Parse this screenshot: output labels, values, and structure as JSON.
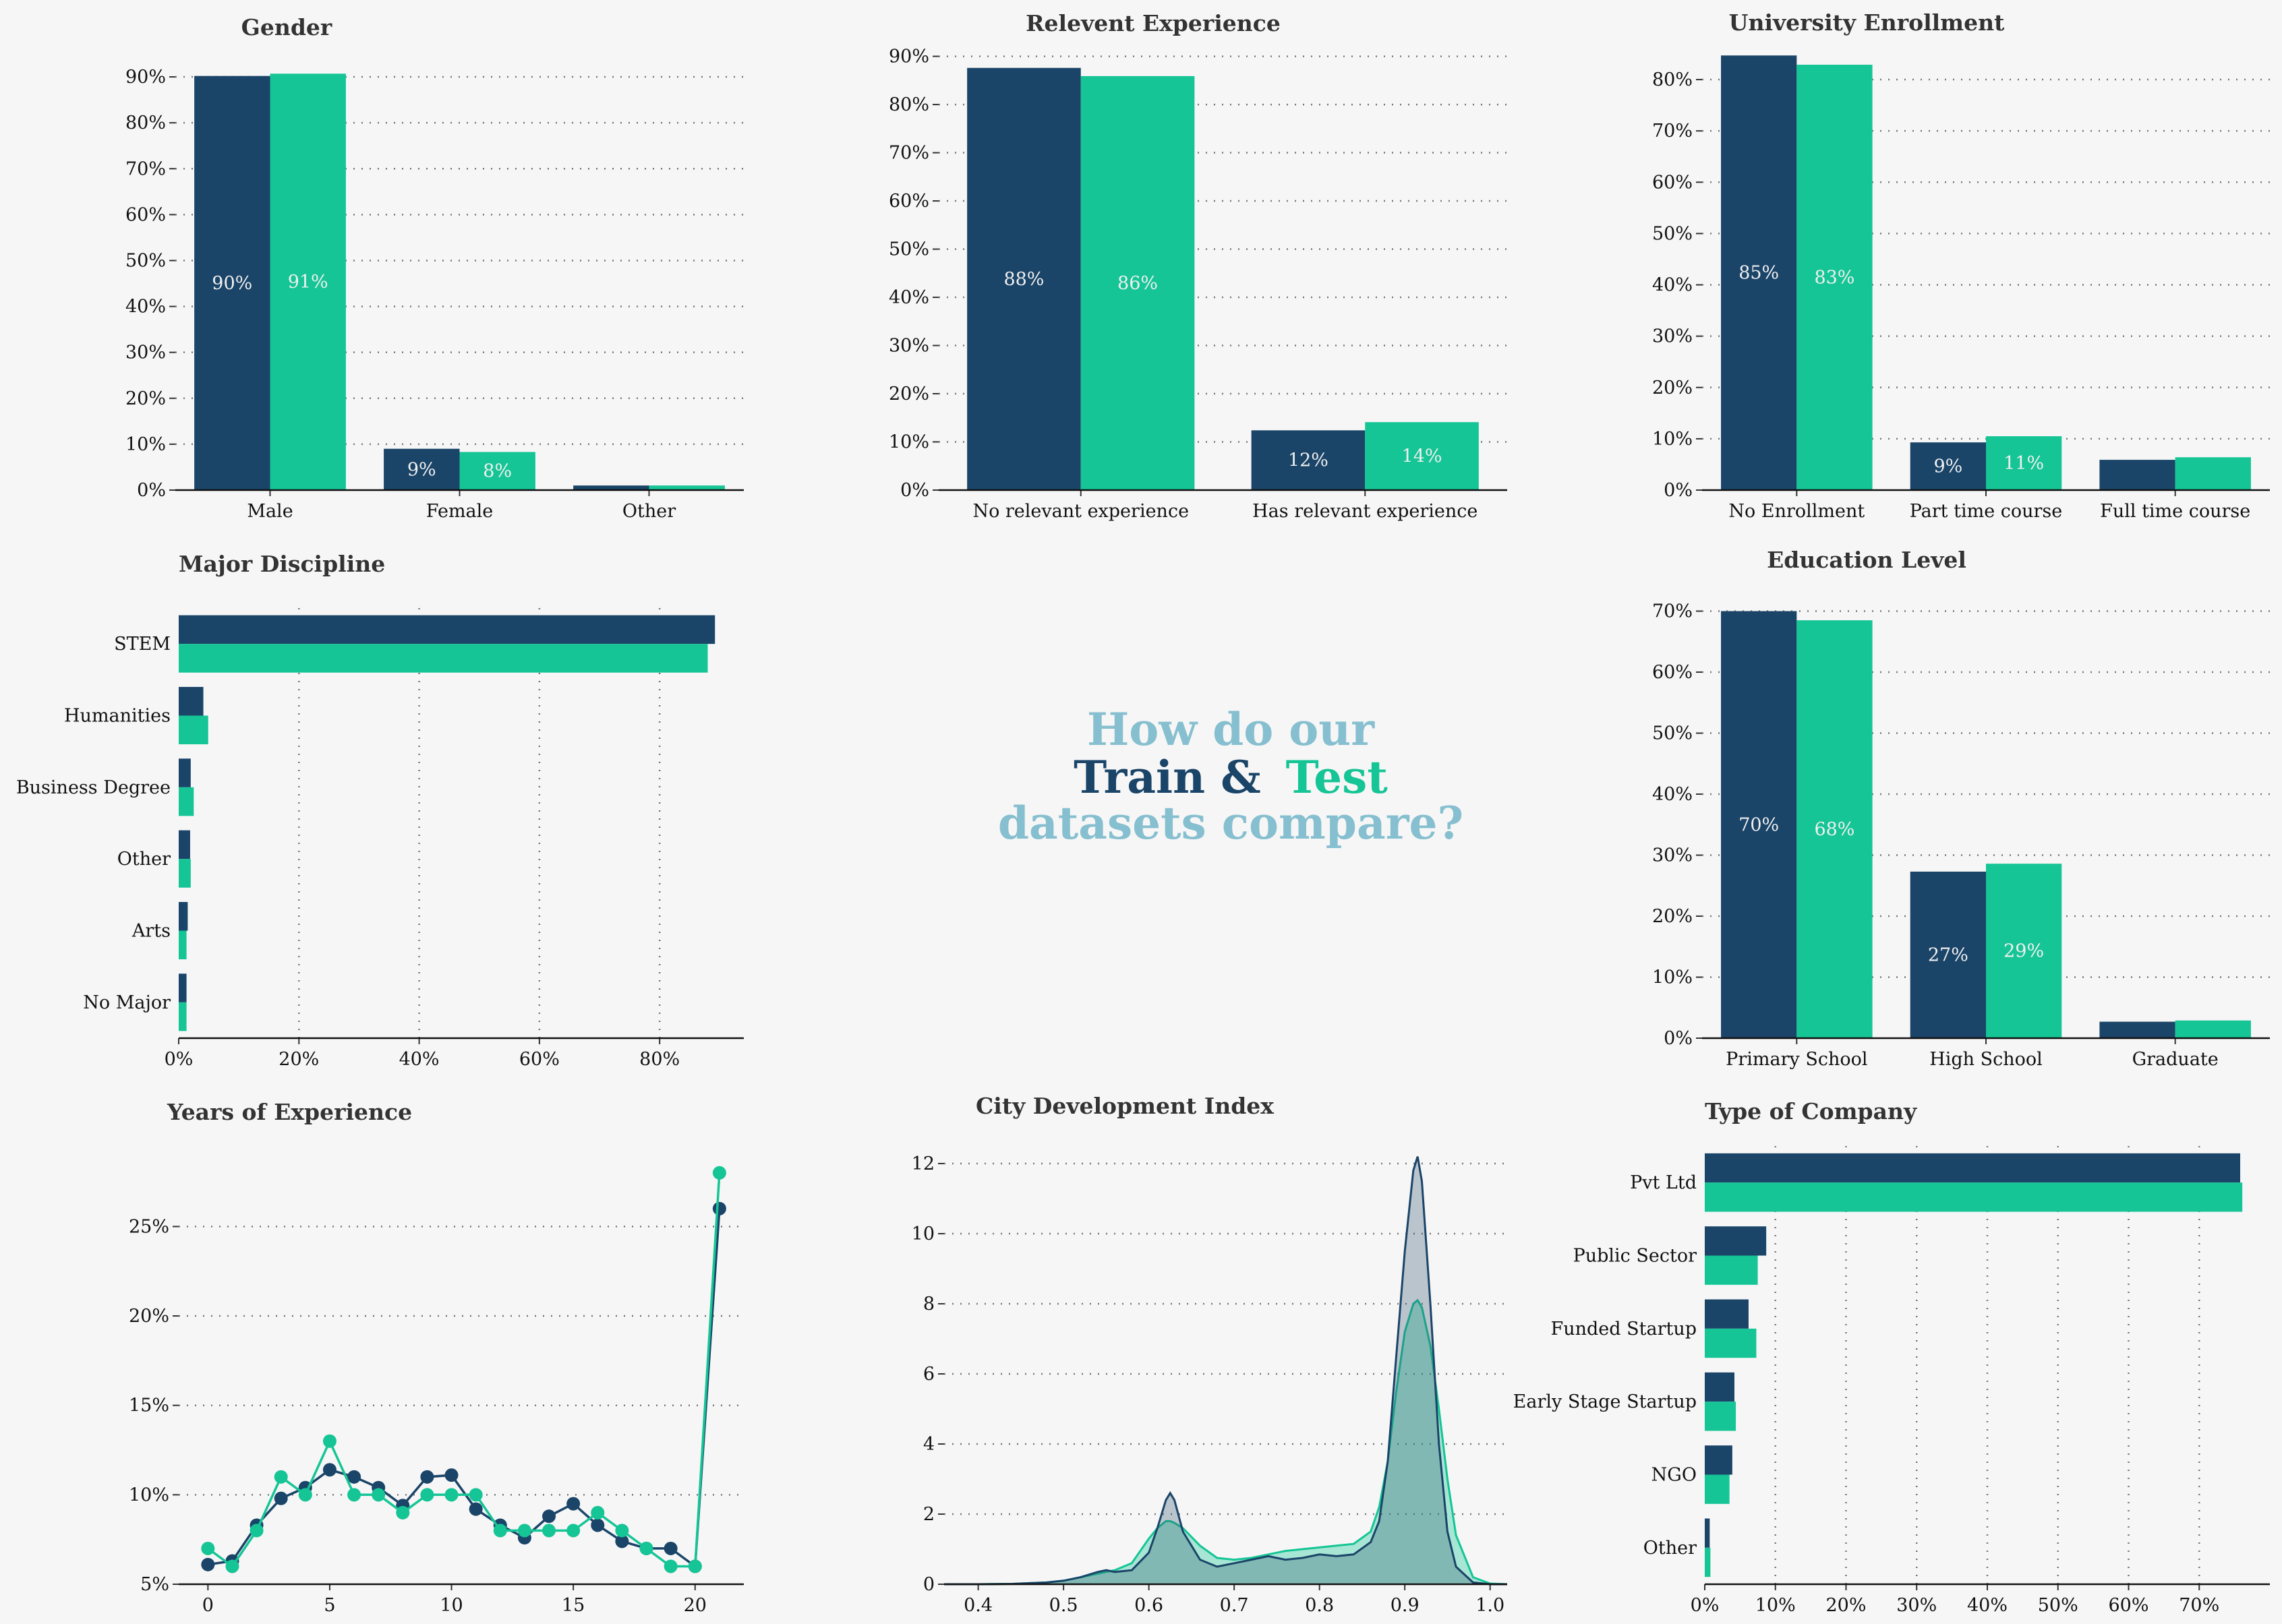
{
  "colors": {
    "background": "#f6f6f6",
    "train": "#1a4468",
    "test": "#15c595",
    "accent_light": "#86bfcf",
    "title": "#333333",
    "grid": "#777777"
  },
  "center_title": {
    "line1": "How do our",
    "train": "Train",
    "amp": "&",
    "test": "Test",
    "line3": "datasets compare?"
  },
  "chart_data": [
    {
      "id": "gender",
      "type": "bar",
      "title": "Gender",
      "categories": [
        "Male",
        "Female",
        "Other"
      ],
      "series": [
        {
          "values": [
            90.2,
            9.0,
            1.0
          ]
        },
        {
          "values": [
            90.7,
            8.3,
            1.0
          ]
        }
      ],
      "ylim": [
        0,
        95
      ],
      "yticks": [
        0,
        10,
        20,
        30,
        40,
        50,
        60,
        70,
        80,
        90
      ],
      "tick_labels": [
        "0%",
        "10%",
        "20%",
        "30%",
        "40%",
        "50%",
        "60%",
        "70%",
        "80%",
        "90%"
      ],
      "data_labels": [
        [
          "90%",
          "9%",
          ""
        ],
        [
          "91%",
          "8%",
          ""
        ]
      ],
      "grid": true
    },
    {
      "id": "experience",
      "type": "bar",
      "title": "Relevent Experience",
      "categories": [
        "No relevant experience",
        "Has relevant experience"
      ],
      "series": [
        {
          "values": [
            87.6,
            12.4
          ]
        },
        {
          "values": [
            85.9,
            14.1
          ]
        }
      ],
      "ylim": [
        0,
        90.5
      ],
      "yticks": [
        0,
        10,
        20,
        30,
        40,
        50,
        60,
        70,
        80,
        90
      ],
      "tick_labels": [
        "0%",
        "10%",
        "20%",
        "30%",
        "40%",
        "50%",
        "60%",
        "70%",
        "80%",
        "90%"
      ],
      "data_labels": [
        [
          "88%",
          "12%"
        ],
        [
          "86%",
          "14%"
        ]
      ],
      "grid": true
    },
    {
      "id": "enrollment",
      "type": "bar",
      "title": "University Enrollment",
      "categories": [
        "No Enrollment",
        "Part time course",
        "Full time course"
      ],
      "series": [
        {
          "values": [
            84.7,
            9.3,
            5.9
          ]
        },
        {
          "values": [
            82.9,
            10.5,
            6.4
          ]
        }
      ],
      "ylim": [
        0,
        85
      ],
      "yticks": [
        0,
        10,
        20,
        30,
        40,
        50,
        60,
        70,
        80
      ],
      "tick_labels": [
        "0%",
        "10%",
        "20%",
        "30%",
        "40%",
        "50%",
        "60%",
        "70%",
        "80%"
      ],
      "data_labels": [
        [
          "85%",
          "9%",
          ""
        ],
        [
          "83%",
          "11%",
          ""
        ]
      ],
      "grid": true
    },
    {
      "id": "discipline",
      "type": "bar",
      "orientation": "horizontal",
      "title": "Major Discipline",
      "categories": [
        "STEM",
        "Humanities",
        "Business Degree",
        "Other",
        "Arts",
        "No Major"
      ],
      "series": [
        {
          "values": [
            89.2,
            4.1,
            2.0,
            1.9,
            1.5,
            1.3
          ]
        },
        {
          "values": [
            88.0,
            4.9,
            2.5,
            2.0,
            1.3,
            1.3
          ]
        }
      ],
      "xlim": [
        0,
        94
      ],
      "xticks": [
        0,
        20,
        40,
        60,
        80
      ],
      "tick_labels": [
        "0%",
        "20%",
        "40%",
        "60%",
        "80%"
      ],
      "grid": true
    },
    {
      "id": "education",
      "type": "bar",
      "title": "Education Level",
      "categories": [
        "Primary School",
        "High School",
        "Graduate"
      ],
      "series": [
        {
          "values": [
            70.0,
            27.3,
            2.7
          ]
        },
        {
          "values": [
            68.5,
            28.6,
            2.9
          ]
        }
      ],
      "ylim": [
        0,
        70.5
      ],
      "yticks": [
        0,
        10,
        20,
        30,
        40,
        50,
        60,
        70
      ],
      "tick_labels": [
        "0%",
        "10%",
        "20%",
        "30%",
        "40%",
        "50%",
        "60%",
        "70%"
      ],
      "data_labels": [
        [
          "70%",
          "27%",
          ""
        ],
        [
          "68%",
          "29%",
          ""
        ]
      ],
      "grid": true
    },
    {
      "id": "years",
      "type": "line",
      "title": "Years of Experience",
      "x": [
        0,
        1,
        2,
        3,
        4,
        5,
        6,
        7,
        8,
        9,
        10,
        11,
        12,
        13,
        14,
        15,
        16,
        17,
        18,
        19,
        20,
        21
      ],
      "series": [
        {
          "values": [
            6.1,
            6.3,
            8.3,
            9.8,
            10.4,
            11.4,
            11.0,
            10.4,
            9.4,
            11.0,
            11.1,
            9.2,
            8.3,
            7.6,
            8.8,
            9.5,
            8.3,
            7.4,
            7.0,
            7.0,
            6.0,
            26.0
          ]
        },
        {
          "values": [
            7.0,
            6.0,
            8.0,
            11.0,
            10.0,
            13.0,
            10.0,
            10.0,
            9.0,
            10.0,
            10.0,
            10.0,
            8.0,
            8.0,
            8.0,
            8.0,
            9.0,
            8.0,
            7.0,
            6.0,
            6.0,
            28.0
          ]
        }
      ],
      "xlim": [
        -1.2,
        22.0
      ],
      "ylim": [
        5,
        29.5
      ],
      "xticks": [
        0,
        5,
        10,
        15,
        20
      ],
      "xtick_labels": [
        "0",
        "5",
        "10",
        "15",
        "20"
      ],
      "yticks": [
        5,
        10,
        15,
        20,
        25
      ],
      "ytick_labels": [
        "5%",
        "10%",
        "15%",
        "20%",
        "25%"
      ],
      "grid": true
    },
    {
      "id": "cdi",
      "type": "area",
      "title": "City Development Index",
      "x": [
        0.36,
        0.4,
        0.44,
        0.48,
        0.5,
        0.52,
        0.54,
        0.55,
        0.56,
        0.58,
        0.6,
        0.61,
        0.62,
        0.625,
        0.63,
        0.64,
        0.66,
        0.68,
        0.7,
        0.72,
        0.74,
        0.76,
        0.78,
        0.8,
        0.82,
        0.84,
        0.86,
        0.87,
        0.88,
        0.89,
        0.9,
        0.91,
        0.915,
        0.92,
        0.93,
        0.94,
        0.95,
        0.96,
        0.98,
        1.0,
        1.02
      ],
      "series": [
        {
          "values": [
            0,
            0,
            0.01,
            0.05,
            0.1,
            0.2,
            0.35,
            0.4,
            0.35,
            0.4,
            0.9,
            1.6,
            2.4,
            2.6,
            2.4,
            1.5,
            0.7,
            0.5,
            0.6,
            0.7,
            0.8,
            0.7,
            0.75,
            0.85,
            0.8,
            0.85,
            1.2,
            1.8,
            3.5,
            6.5,
            9.5,
            11.8,
            12.2,
            11.5,
            8.0,
            4.0,
            1.5,
            0.5,
            0.05,
            0,
            0
          ]
        },
        {
          "values": [
            0,
            0,
            0.01,
            0.05,
            0.1,
            0.2,
            0.3,
            0.35,
            0.4,
            0.6,
            1.3,
            1.6,
            1.8,
            1.8,
            1.75,
            1.6,
            1.1,
            0.75,
            0.7,
            0.75,
            0.85,
            0.95,
            1.0,
            1.05,
            1.1,
            1.15,
            1.5,
            2.2,
            3.5,
            5.5,
            7.2,
            8.0,
            8.1,
            7.9,
            6.8,
            5.0,
            3.0,
            1.4,
            0.2,
            0.02,
            0
          ]
        }
      ],
      "xlim": [
        0.36,
        1.02
      ],
      "ylim": [
        0,
        12.5
      ],
      "xticks": [
        0.4,
        0.5,
        0.6,
        0.7,
        0.8,
        0.9,
        1.0
      ],
      "xtick_labels": [
        "0.4",
        "0.5",
        "0.6",
        "0.7",
        "0.8",
        "0.9",
        "1.0"
      ],
      "yticks": [
        0,
        2,
        4,
        6,
        8,
        10,
        12
      ],
      "ytick_labels": [
        "0",
        "2",
        "4",
        "6",
        "8",
        "10",
        "12"
      ],
      "grid": true
    },
    {
      "id": "company",
      "type": "bar",
      "orientation": "horizontal",
      "title": "Type of Company",
      "categories": [
        "Pvt Ltd",
        "Public Sector",
        "Funded Startup",
        "Early Stage Startup",
        "NGO",
        "Other"
      ],
      "series": [
        {
          "values": [
            75.8,
            8.7,
            6.2,
            4.2,
            3.9,
            0.7
          ]
        },
        {
          "values": [
            76.1,
            7.5,
            7.3,
            4.4,
            3.5,
            0.8
          ]
        }
      ],
      "xlim": [
        0,
        80
      ],
      "xticks": [
        0,
        10,
        20,
        30,
        40,
        50,
        60,
        70
      ],
      "tick_labels": [
        "0%",
        "10%",
        "20%",
        "30%",
        "40%",
        "50%",
        "60%",
        "70%"
      ],
      "grid": true
    }
  ]
}
